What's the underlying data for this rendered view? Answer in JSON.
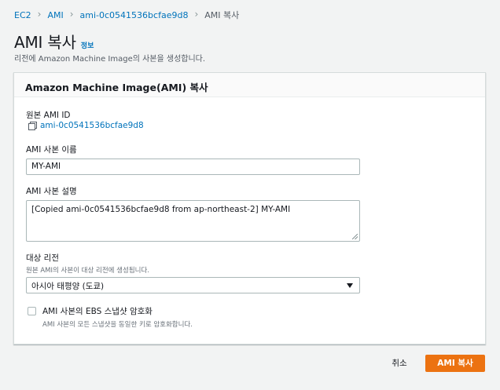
{
  "breadcrumb": {
    "items": [
      "EC2",
      "AMI",
      "ami-0c0541536bcfae9d8"
    ],
    "current": "AMI 복사"
  },
  "header": {
    "title": "AMI 복사",
    "info_link": "정보",
    "description": "리전에 Amazon Machine Image의 사본을 생성합니다."
  },
  "panel": {
    "title": "Amazon Machine Image(AMI) 복사",
    "source_ami": {
      "label": "원본 AMI ID",
      "value": "ami-0c0541536bcfae9d8",
      "icon": "copy-icon"
    },
    "name": {
      "label": "AMI 사본 이름",
      "value": "MY-AMI"
    },
    "description": {
      "label": "AMI 사본 설명",
      "value": "[Copied ami-0c0541536bcfae9d8 from ap-northeast-2] MY-AMI"
    },
    "region": {
      "label": "대상 리전",
      "sublabel": "원본 AMI의 사본이 대상 리전에 생성됩니다.",
      "selected": "아시아 태평양 (도쿄)"
    },
    "encrypt": {
      "label": "AMI 사본의 EBS 스냅샷 암호화",
      "description": "AMI 사본의 모든 스냅샷을 동일한 키로 암호화합니다.",
      "checked": false
    }
  },
  "footer": {
    "cancel_label": "취소",
    "submit_label": "AMI 복사"
  },
  "colors": {
    "link": "#0073bb",
    "primary": "#ec7211",
    "background": "#f2f3f3"
  }
}
